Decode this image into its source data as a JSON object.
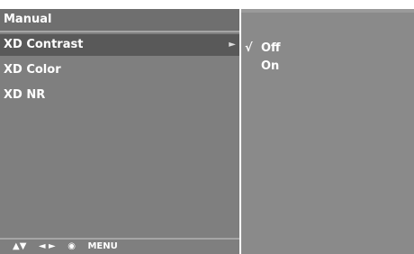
{
  "menu": {
    "title": "Manual",
    "items": [
      {
        "label": "XD Contrast",
        "arrow": "►"
      },
      {
        "label": "XD Color"
      },
      {
        "label": "XD NR"
      }
    ],
    "nav": {
      "updown": "▲▼",
      "leftright": "◄ ►",
      "ok": "◉",
      "menu": "MENU"
    }
  },
  "submenu": {
    "options": [
      {
        "check": "√",
        "label": "Off"
      },
      {
        "check": "",
        "label": "On"
      }
    ]
  }
}
